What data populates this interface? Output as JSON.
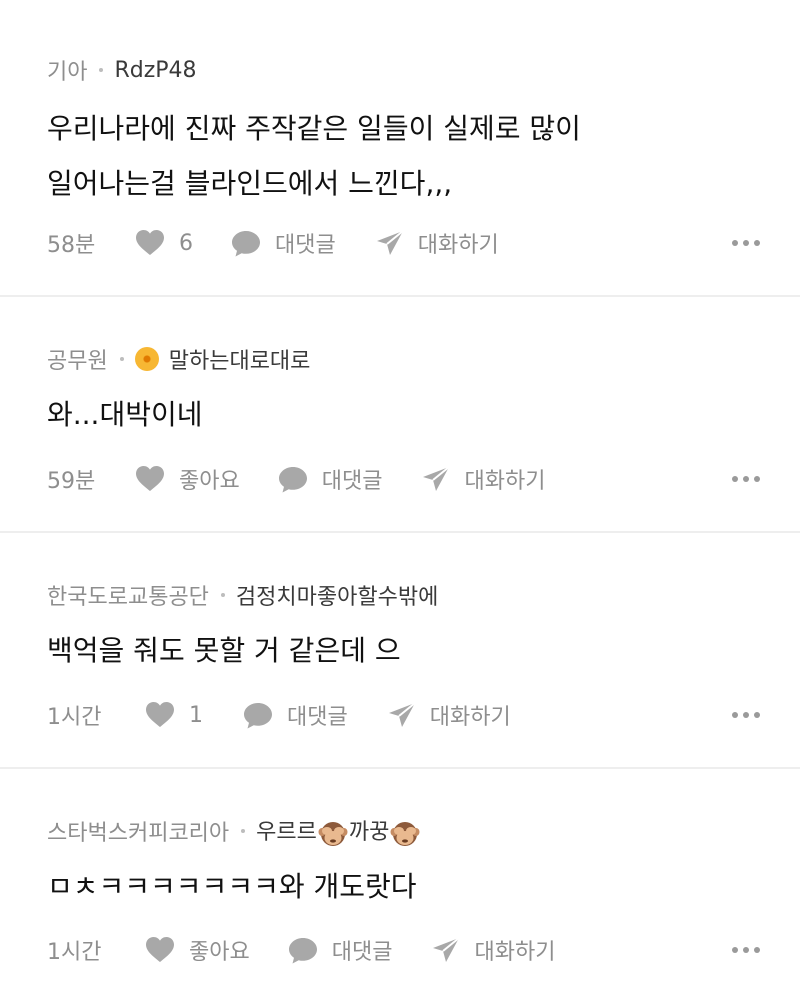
{
  "comments": [
    {
      "company": "기아",
      "nickname": "RdzP48",
      "body_lines": [
        "우리나라에 진짜 주작같은 일들이 실제로 많이",
        "일어나는걸 블라인드에서 느낀다,,,"
      ],
      "time": "58분",
      "like_label": "6",
      "reply_label": "대댓글",
      "chat_label": "대화하기"
    },
    {
      "company": "공무원",
      "nickname": "말하는대로대로",
      "body_lines": [
        "와...대박이네"
      ],
      "time": "59분",
      "like_label": "좋아요",
      "reply_label": "대댓글",
      "chat_label": "대화하기"
    },
    {
      "company": "한국도로교통공단",
      "nickname": "검정치마좋아할수밖에",
      "body_lines": [
        "백억을 줘도 못할 거 같은데 으"
      ],
      "time": "1시간",
      "like_label": "1",
      "reply_label": "대댓글",
      "chat_label": "대화하기"
    },
    {
      "company": "스타벅스커피코리아",
      "nickname_parts": [
        "우르르",
        "까꿍"
      ],
      "body_lines": [
        "ㅁㅊㅋㅋㅋㅋㅋㅋㅋ와 개도랏다"
      ],
      "time": "1시간",
      "like_label": "좋아요",
      "reply_label": "대댓글",
      "chat_label": "대화하기"
    }
  ],
  "icons": {
    "like": "heart-icon",
    "reply": "speech-bubble-icon",
    "chat": "paper-plane-icon",
    "more": "more-dots-icon",
    "badge": "sun-badge-icon",
    "emoji": "see-no-evil-monkey-icon"
  },
  "colors": {
    "meta_text": "#8e8e8e",
    "body_text": "#111111",
    "icon": "#a8a8a8",
    "divider": "#eeeeee"
  }
}
